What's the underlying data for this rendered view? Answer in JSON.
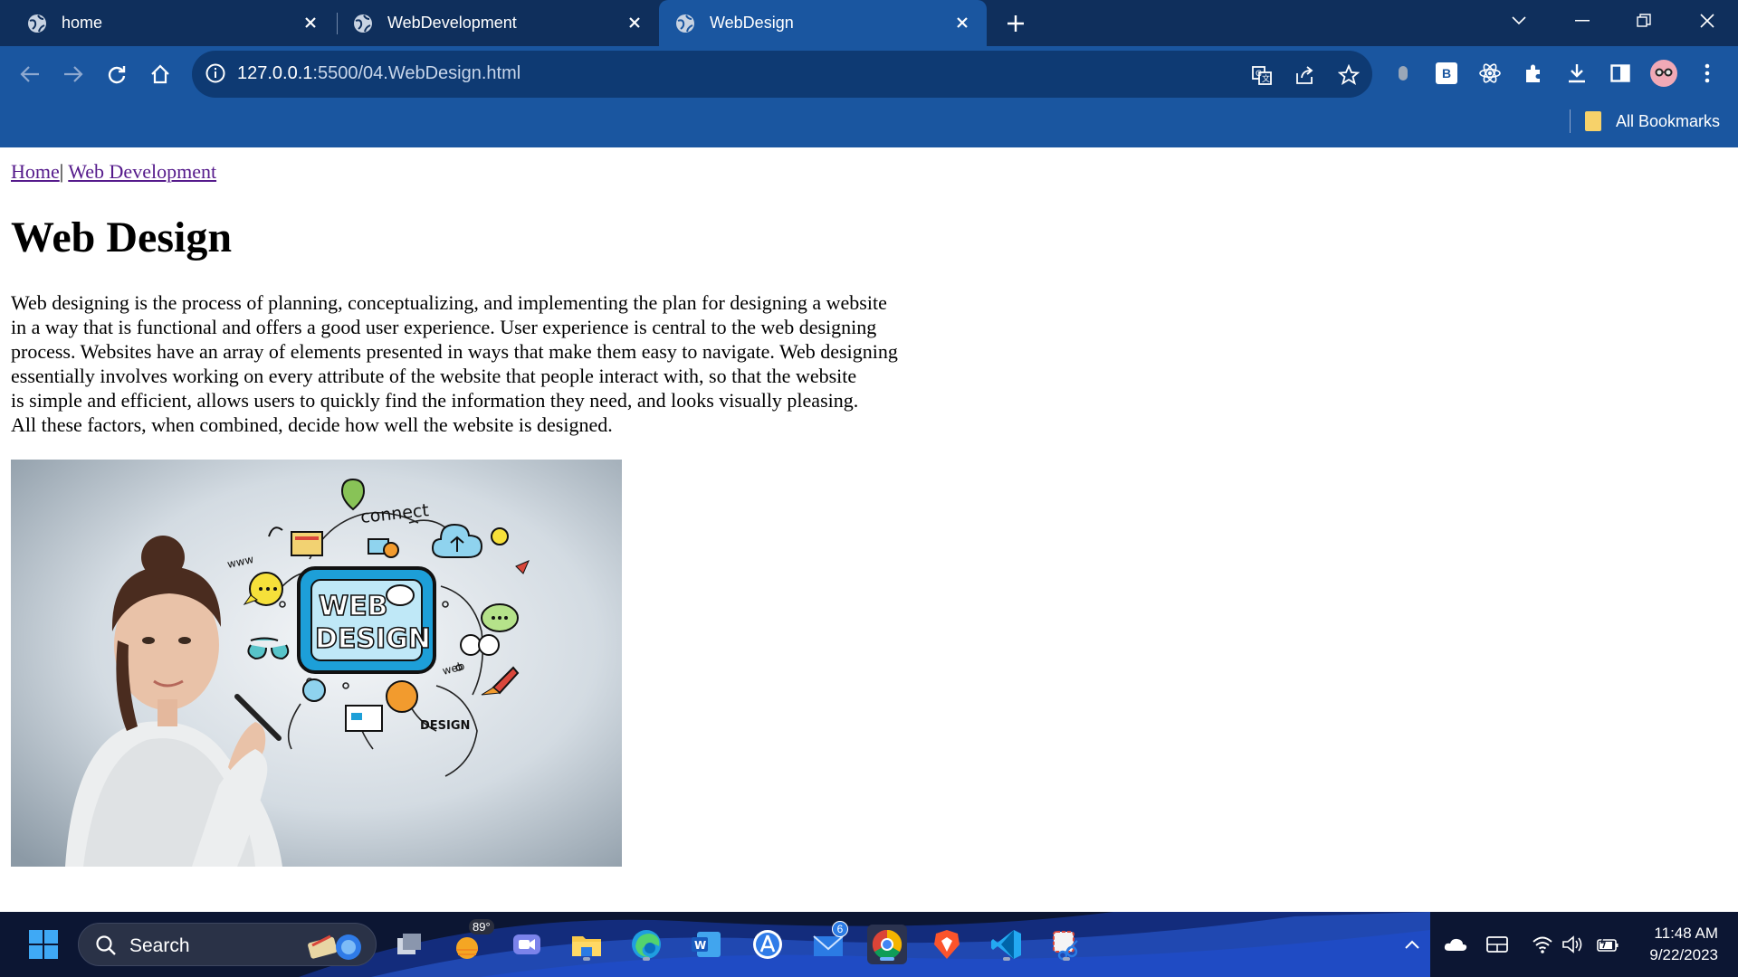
{
  "browser": {
    "tabs": [
      {
        "label": "home",
        "active": false
      },
      {
        "label": "WebDevelopment",
        "active": false
      },
      {
        "label": "WebDesign",
        "active": true
      }
    ],
    "address_bar": {
      "host": "127.0.0.1",
      "path": ":5500/04.WebDesign.html"
    },
    "bookmarks_label": "All Bookmarks",
    "extension_badge": "B"
  },
  "page": {
    "breadcrumb": {
      "home": "Home",
      "separator": "|",
      "web_development": "Web Development"
    },
    "title": "Web Design",
    "paragraph_lines": [
      "Web designing is the process of planning, conceptualizing, and implementing the plan for designing a website",
      "in a way that is functional and offers a good user experience. User experience is central to the web designing",
      "process. Websites have an array of elements presented in ways that make them easy to navigate. Web designing",
      "essentially involves working on every attribute of the website that people interact with, so that the website",
      "is simple and efficient, allows users to quickly find the information they need, and looks visually pleasing.",
      "All these factors, when combined, decide how well the website is designed."
    ],
    "image": {
      "screen_text": [
        "WEB",
        "DESIGN"
      ],
      "doodle_words": [
        "connect",
        "www",
        "web",
        "DESIGN"
      ]
    }
  },
  "taskbar": {
    "search_label": "Search",
    "weather_temp": "89°",
    "mail_badge": "6",
    "clock_time": "11:48 AM",
    "clock_date": "9/22/2023"
  },
  "colors": {
    "tabbar": "#0f2f5c",
    "toolbar": "#1a56a0",
    "link": "#551a8b",
    "taskbar": "#0c1633"
  }
}
